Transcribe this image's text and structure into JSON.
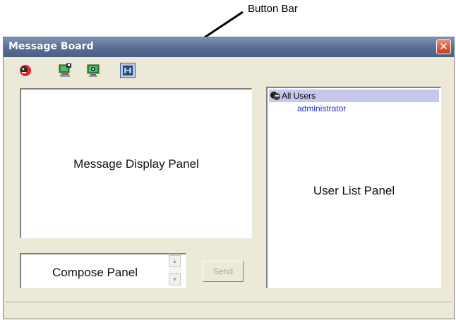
{
  "annotation": {
    "text": "Button Bar"
  },
  "window": {
    "title": "Message Board",
    "close_glyph": "✕"
  },
  "toolbar": {
    "buttons": [
      {
        "icon": "stop-sign-face-icon"
      },
      {
        "icon": "monitor-lock-icon"
      },
      {
        "icon": "monitor-eye-icon"
      },
      {
        "icon": "board-pressed-icon",
        "state": "pressed"
      }
    ]
  },
  "message_display": {
    "label": "Message Display Panel"
  },
  "compose": {
    "label": "Compose Panel",
    "send_label": "Send"
  },
  "user_list": {
    "all_users_label": "All Users",
    "users": [
      "administrator"
    ],
    "label": "User List Panel"
  },
  "colors": {
    "title_bar": "#5a6f94",
    "window_bg": "#ece9d8",
    "close_btn": "#cc3a1b",
    "selected_row": "#c7c6ec",
    "user_link": "#1e2fd0"
  }
}
